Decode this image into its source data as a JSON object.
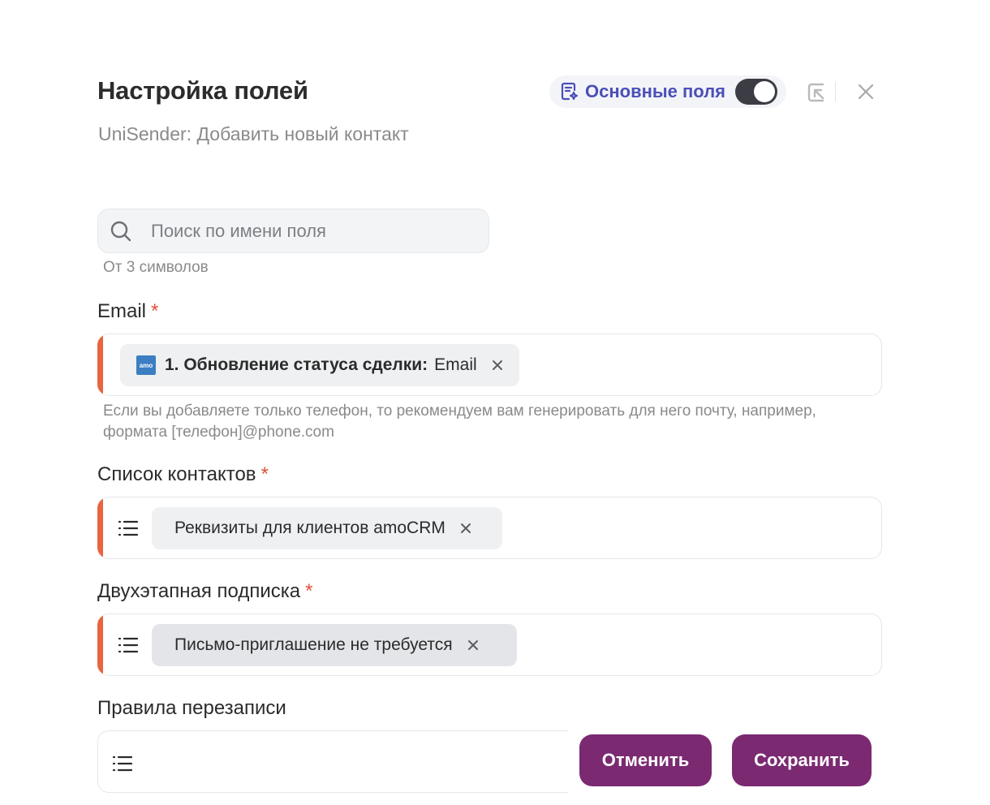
{
  "header": {
    "title": "Настройка полей",
    "subtitle": "UniSender: Добавить новый контакт",
    "mode_label": "Основные поля",
    "mode_toggle_on": true
  },
  "search": {
    "placeholder": "Поиск по имени поля",
    "value": "",
    "hint": "От 3 символов"
  },
  "fields": [
    {
      "label": "Email",
      "required_mark": "*",
      "chip_source": "1. Обновление статуса сделки:",
      "chip_value": "Email",
      "badge_text": "amo",
      "help": "Если вы добавляете только телефон, то рекомендуем вам генерировать для него почту, например, формата [телефон]@phone.com"
    },
    {
      "label": "Список контактов",
      "required_mark": "*",
      "chip_value": "Реквизиты для клиентов amoCRM"
    },
    {
      "label": "Двухэтапная подписка",
      "required_mark": "*",
      "chip_value": "Письмо-приглашение не требуется"
    },
    {
      "label": "Правила перезаписи"
    }
  ],
  "actions": {
    "cancel_label": "Отменить",
    "save_label": "Сохранить"
  },
  "colors": {
    "accent_bar": "#e8653f",
    "primary_button": "#7b2a72",
    "mode_label": "#4a4fb8",
    "required": "#e0503a"
  }
}
